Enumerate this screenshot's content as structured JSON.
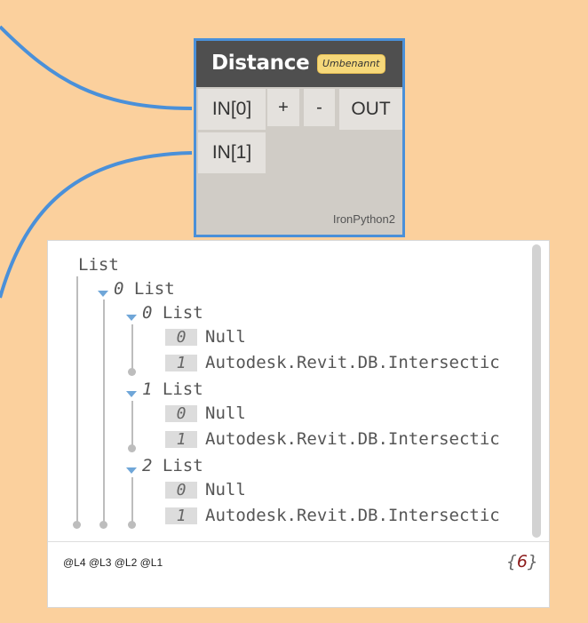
{
  "node": {
    "title": "Distance",
    "badge": "Umbenannt",
    "inputs": [
      "IN[0]",
      "IN[1]"
    ],
    "add_label": "+",
    "remove_label": "-",
    "output": "OUT",
    "engine": "IronPython2"
  },
  "preview": {
    "root_label": "List",
    "level1": {
      "index": "0",
      "label": "List"
    },
    "groups": [
      {
        "index": "0",
        "label": "List",
        "items": [
          {
            "index": "0",
            "value": "Null"
          },
          {
            "index": "1",
            "value": "Autodesk.Revit.DB.Intersectic"
          }
        ]
      },
      {
        "index": "1",
        "label": "List",
        "items": [
          {
            "index": "0",
            "value": "Null"
          },
          {
            "index": "1",
            "value": "Autodesk.Revit.DB.Intersectic"
          }
        ]
      },
      {
        "index": "2",
        "label": "List",
        "items": [
          {
            "index": "0",
            "value": "Null"
          },
          {
            "index": "1",
            "value": "Autodesk.Revit.DB.Intersectic"
          }
        ]
      }
    ],
    "levels": "@L4 @L3 @L2  @L1",
    "count_open": "{",
    "count_value": "6",
    "count_close": "}"
  },
  "colors": {
    "canvas": "#FBD09D",
    "wire": "#4A90D9",
    "node_border": "#4A90D9",
    "node_header": "#4F4F4F",
    "badge": "#F6D87A"
  }
}
